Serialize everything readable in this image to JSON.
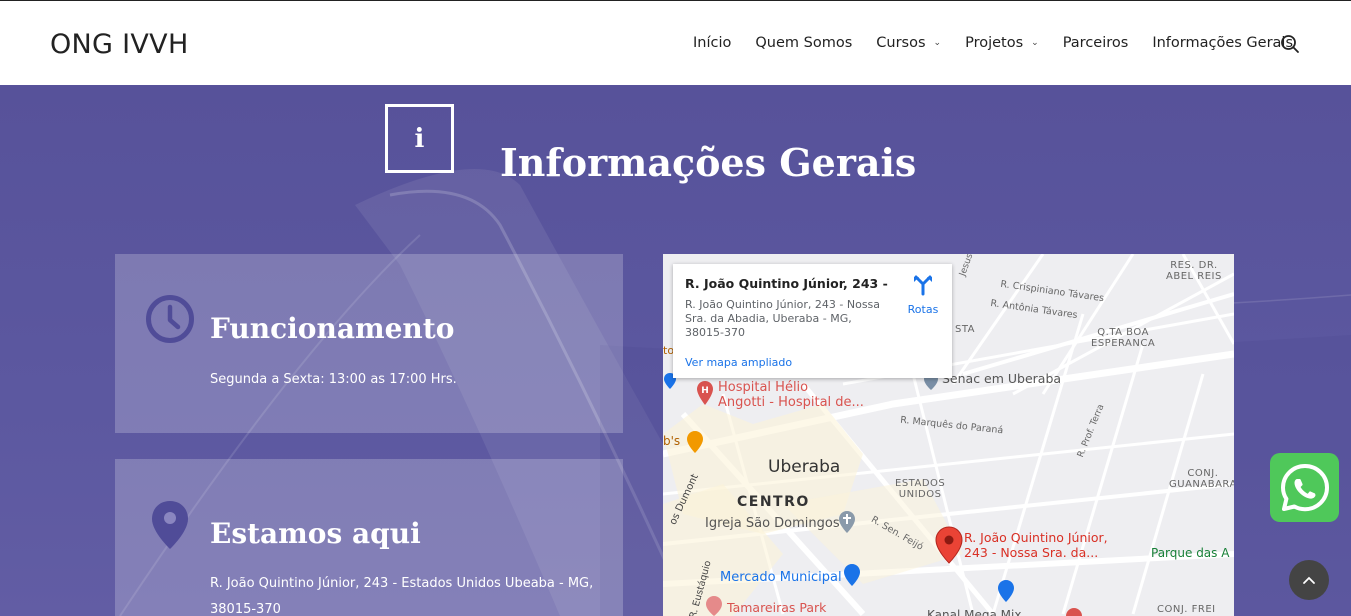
{
  "header": {
    "logo": "ONG IVVH",
    "nav": [
      {
        "label": "Início"
      },
      {
        "label": "Quem Somos"
      },
      {
        "label": "Cursos",
        "dropdown": true
      },
      {
        "label": "Projetos",
        "dropdown": true
      },
      {
        "label": "Parceiros"
      },
      {
        "label": "Informações Gerais"
      }
    ]
  },
  "hero": {
    "info_icon_glyph": "i",
    "title": "Informações Gerais"
  },
  "cards": {
    "hours": {
      "title": "Funcionamento",
      "text": "Segunda a Sexta: 13:00 as 17:00 Hrs."
    },
    "location": {
      "title": "Estamos aqui",
      "text": "R. João Quintino Júnior, 243 - Estados Unidos Ubeaba - MG, 38015-370"
    }
  },
  "map": {
    "popup": {
      "title": "R. João Quintino Júnior, 243 - ...",
      "address": "R. João Quintino Júnior, 243 - Nossa Sra. da Abadia, Uberaba - MG, 38015-370",
      "routes_label": "Rotas",
      "larger_map_link": "Ver mapa ampliado"
    },
    "labels": {
      "city": "Uberaba",
      "centro": "CENTRO",
      "hospital_line1": "Hospital Hélio",
      "hospital_line2": "Angotti - Hospital de...",
      "senac": "Senac em Uberaba",
      "igreja": "Igreja São Domingos",
      "mercado": "Mercado Municipal",
      "tamareiras": "Tamareiras Park",
      "pin_line1": "R. João Quintino Júnior,",
      "pin_line2": "243 - Nossa Sra. da...",
      "estados_unidos_1": "ESTADOS",
      "estados_unidos_2": "UNIDOS",
      "res_abel_1": "RES. DR.",
      "res_abel_2": "ABEL REIS",
      "qta_boa_1": "Q.TA BOA",
      "qta_boa_2": "ESPERANCA",
      "conj_guanabara_1": "CONJ.",
      "conj_guanabara_2": "GUANABARA",
      "parque": "Parque das A",
      "conj_frei": "CONJ. FREI",
      "sta": "STA",
      "crispiniano": "R. Crispiniano Távares",
      "antonia": "R. Antônia Távares",
      "marques": "R. Marquês do Paraná",
      "sen_feijo": "R. Sen. Feijó",
      "prof_terra": "R. Prof. Terra",
      "dumont": "os Dumont",
      "eustaquio": "R. Eustáquio",
      "bs": "b's",
      "to": "to",
      "jesus": "Jesus",
      "kanal": "Kanal Mega Mix"
    },
    "colors": {
      "pin": "#ea4335",
      "poi_red": "#d9534f",
      "poi_blue": "#1a73e8",
      "poi_orange": "#f29900",
      "park_green": "#188038"
    }
  },
  "floating": {
    "whatsapp_icon": "whatsapp-icon",
    "scroll_top_icon": "chevron-up-icon"
  }
}
